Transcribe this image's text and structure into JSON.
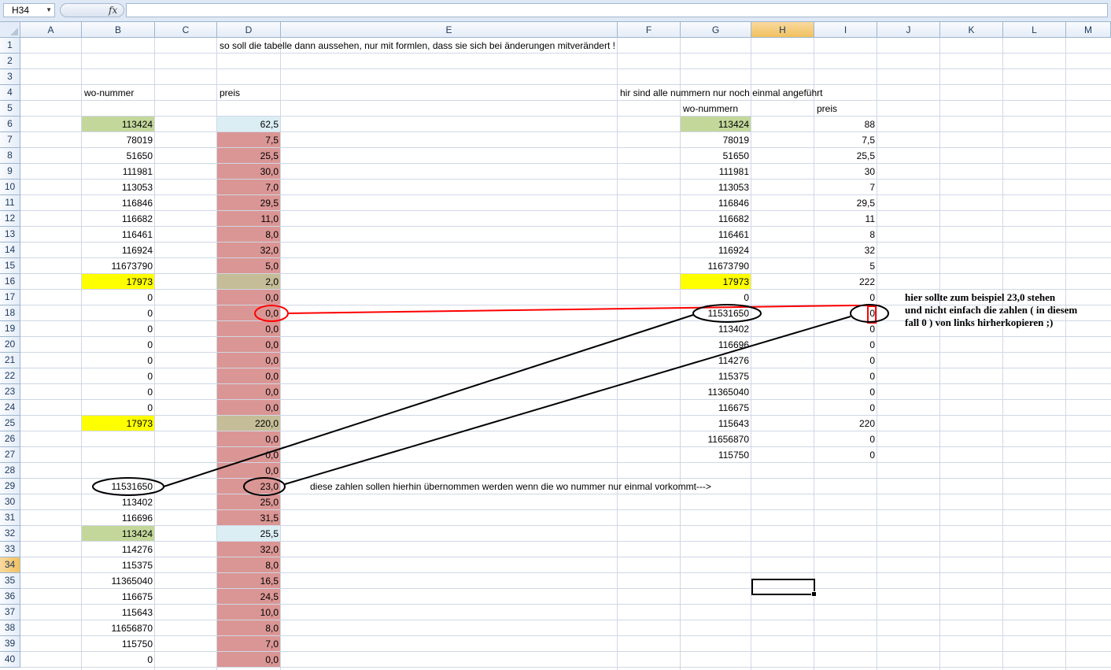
{
  "formula_bar": {
    "name_box": "H34",
    "fx_label": "fx",
    "formula": ""
  },
  "columns": [
    "A",
    "B",
    "C",
    "D",
    "E",
    "F",
    "G",
    "H",
    "I",
    "J",
    "K",
    "L",
    "M"
  ],
  "rows": [
    "1",
    "2",
    "3",
    "4",
    "5",
    "6",
    "7",
    "8",
    "9",
    "10",
    "11",
    "12",
    "13",
    "14",
    "15",
    "16",
    "17",
    "18",
    "19",
    "20",
    "21",
    "22",
    "23",
    "24",
    "25",
    "26",
    "27",
    "28",
    "29",
    "30",
    "31",
    "32",
    "33",
    "34",
    "35",
    "36",
    "37",
    "38",
    "39",
    "40"
  ],
  "active_cell": {
    "column": "H",
    "row": "34"
  },
  "colors": {
    "green": "#c4d79b",
    "lightblue": "#dbeef4",
    "yellow": "#ffff00",
    "red": "#da9694",
    "tan": "#c4bd97",
    "annotation_red": "#ff0000",
    "annotation_black": "#000000"
  },
  "title": "so soll die tabelle dann aussehen, nur mit formlen, dass sie sich bei änderungen mitverändert !",
  "left_table": {
    "header_number": "wo-nummer",
    "header_price": "preis",
    "numbers": [
      "113424",
      "78019",
      "51650",
      "111981",
      "113053",
      "116846",
      "116682",
      "116461",
      "116924",
      "11673790",
      "17973",
      "0",
      "0",
      "0",
      "0",
      "0",
      "0",
      "0",
      "0",
      "17973",
      "",
      "",
      "",
      "11531650",
      "113402",
      "116696",
      "113424",
      "114276",
      "115375",
      "11365040",
      "116675",
      "115643",
      "11656870",
      "115750",
      "0"
    ],
    "prices": [
      "62,5",
      "7,5",
      "25,5",
      "30,0",
      "7,0",
      "29,5",
      "11,0",
      "8,0",
      "32,0",
      "5,0",
      "2,0",
      "0,0",
      "0,0",
      "0,0",
      "0,0",
      "0,0",
      "0,0",
      "0,0",
      "0,0",
      "220,0",
      "0,0",
      "0,0",
      "0,0",
      "23,0",
      "25,0",
      "31,5",
      "25,5",
      "32,0",
      "8,0",
      "16,5",
      "24,5",
      "10,0",
      "8,0",
      "7,0",
      "0,0"
    ],
    "number_fills": [
      "green",
      "",
      "",
      "",
      "",
      "",
      "",
      "",
      "",
      "",
      "yellow",
      "",
      "",
      "",
      "",
      "",
      "",
      "",
      "",
      "yellow",
      "",
      "",
      "",
      "",
      "",
      "",
      "green",
      "",
      "",
      "",
      "",
      "",
      "",
      "",
      ""
    ],
    "price_fills": [
      "lightblue",
      "red",
      "red",
      "red",
      "red",
      "red",
      "red",
      "red",
      "red",
      "red",
      "tan",
      "red",
      "red",
      "red",
      "red",
      "red",
      "red",
      "red",
      "red",
      "tan",
      "red",
      "red",
      "red",
      "red",
      "red",
      "red",
      "lightblue",
      "red",
      "red",
      "red",
      "red",
      "red",
      "red",
      "red",
      "red"
    ]
  },
  "right_table": {
    "caption": "hir sind alle nummern nur noch einmal angeführt",
    "header_number": "wo-nummern",
    "header_price": "preis",
    "numbers": [
      "113424",
      "78019",
      "51650",
      "111981",
      "113053",
      "116846",
      "116682",
      "116461",
      "116924",
      "11673790",
      "17973",
      "0",
      "11531650",
      "113402",
      "116696",
      "114276",
      "115375",
      "11365040",
      "116675",
      "115643",
      "11656870",
      "115750"
    ],
    "prices": [
      "88",
      "7,5",
      "25,5",
      "30",
      "7",
      "29,5",
      "11",
      "8",
      "32",
      "5",
      "222",
      "0",
      "0",
      "0",
      "0",
      "0",
      "0",
      "0",
      "0",
      "220",
      "0",
      "0"
    ],
    "number_fills": [
      "green",
      "",
      "",
      "",
      "",
      "",
      "",
      "",
      "",
      "",
      "yellow",
      "",
      "",
      "",
      "",
      "",
      "",
      "",
      "",
      "",
      "",
      ""
    ]
  },
  "note_right": [
    "hier sollte zum beispiel 23,0 stehen",
    "und nicht einfach die zahlen ( in diesem",
    "fall 0 ) von links hirherkopieren ;)"
  ],
  "note_row29": "diese zahlen sollen hierhin übernommen werden wenn die wo nummer nur einmal vorkommt--->"
}
